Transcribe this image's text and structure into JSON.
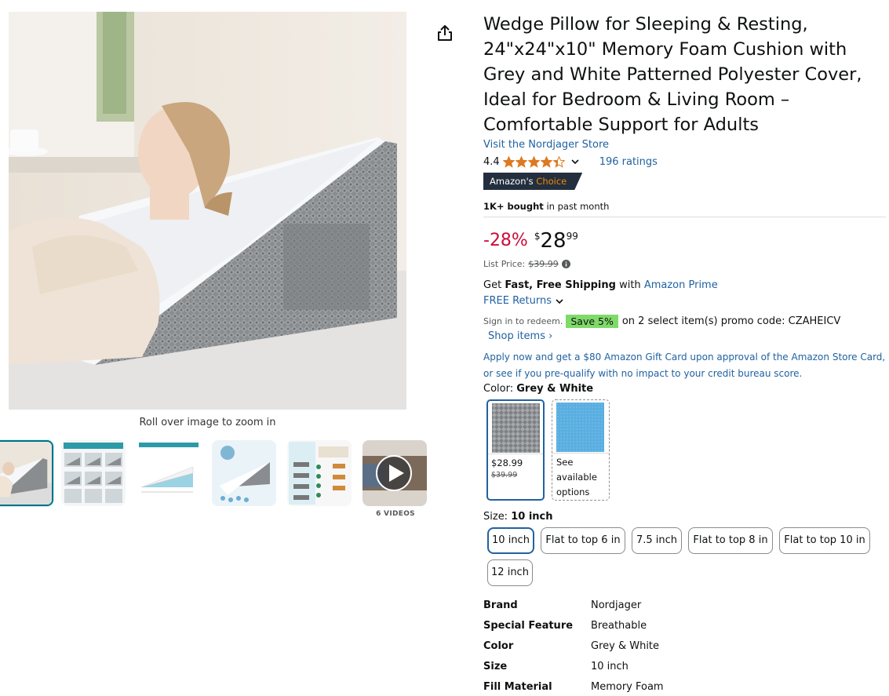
{
  "gallery": {
    "zoom_hint": "Roll over image to zoom in",
    "videos_count": "6 VIDEOS",
    "thumbnails": [
      {
        "kind": "image",
        "alt": "main"
      },
      {
        "kind": "image",
        "alt": "positions"
      },
      {
        "kind": "image",
        "alt": "dimensions"
      },
      {
        "kind": "image",
        "alt": "cover"
      },
      {
        "kind": "image",
        "alt": "comparison"
      },
      {
        "kind": "video",
        "alt": "video"
      }
    ]
  },
  "product": {
    "title": "Wedge Pillow for Sleeping & Resting, 24\"x24\"x10\" Memory Foam Cushion with Grey and White Patterned Polyester Cover, Ideal for Bedroom & Living Room – Comfortable Support for Adults",
    "store_link": "Visit the Nordjager Store",
    "rating_value": "4.4",
    "rating_stars": 4.4,
    "ratings_count": "196 ratings",
    "badge_prefix": "Amazon's ",
    "badge_accent": "Choice",
    "bought_bold": "1K+ bought",
    "bought_rest": " in past month"
  },
  "price": {
    "discount": "-28%",
    "symbol": "$",
    "whole": "28",
    "fraction": "99",
    "list_label": "List Price:",
    "list_value": "$39.99"
  },
  "shipping": {
    "get": "Get ",
    "fast": "Fast, Free Shipping",
    "with": " with ",
    "prime": "Amazon Prime",
    "returns": "FREE Returns"
  },
  "promo": {
    "signin": "Sign in to redeem.",
    "save": "Save 5%",
    "rest": "on 2 select item(s) promo code: CZAHEICV",
    "shop_items": "Shop items ›"
  },
  "card_offer": "Apply now and get a $80 Amazon Gift Card upon approval of the Amazon Store Card, or see if you pre-qualify with no impact to your credit bureau score.",
  "color": {
    "label": "Color: ",
    "selected": "Grey & White",
    "options": [
      {
        "price": "$28.99",
        "list": "$39.99"
      },
      {
        "text": "See available options"
      }
    ]
  },
  "size": {
    "label": "Size: ",
    "selected": "10 inch",
    "options": [
      "10 inch",
      "Flat to top 6 in",
      "7.5 inch",
      "Flat to top 8 in",
      "Flat to top 10 in",
      "12 inch"
    ]
  },
  "specs": [
    {
      "key": "Brand",
      "value": "Nordjager"
    },
    {
      "key": "Special Feature",
      "value": "Breathable"
    },
    {
      "key": "Color",
      "value": "Grey & White"
    },
    {
      "key": "Size",
      "value": "10 inch"
    },
    {
      "key": "Fill Material",
      "value": "Memory Foam"
    }
  ],
  "colors": {
    "link": "#2162a1",
    "discount": "#cc0c39",
    "star": "#de7921",
    "badge_bg": "#232f3e",
    "badge_accent": "#f08804",
    "save_bg": "#7fda69",
    "selected_border": "#2162a1"
  }
}
